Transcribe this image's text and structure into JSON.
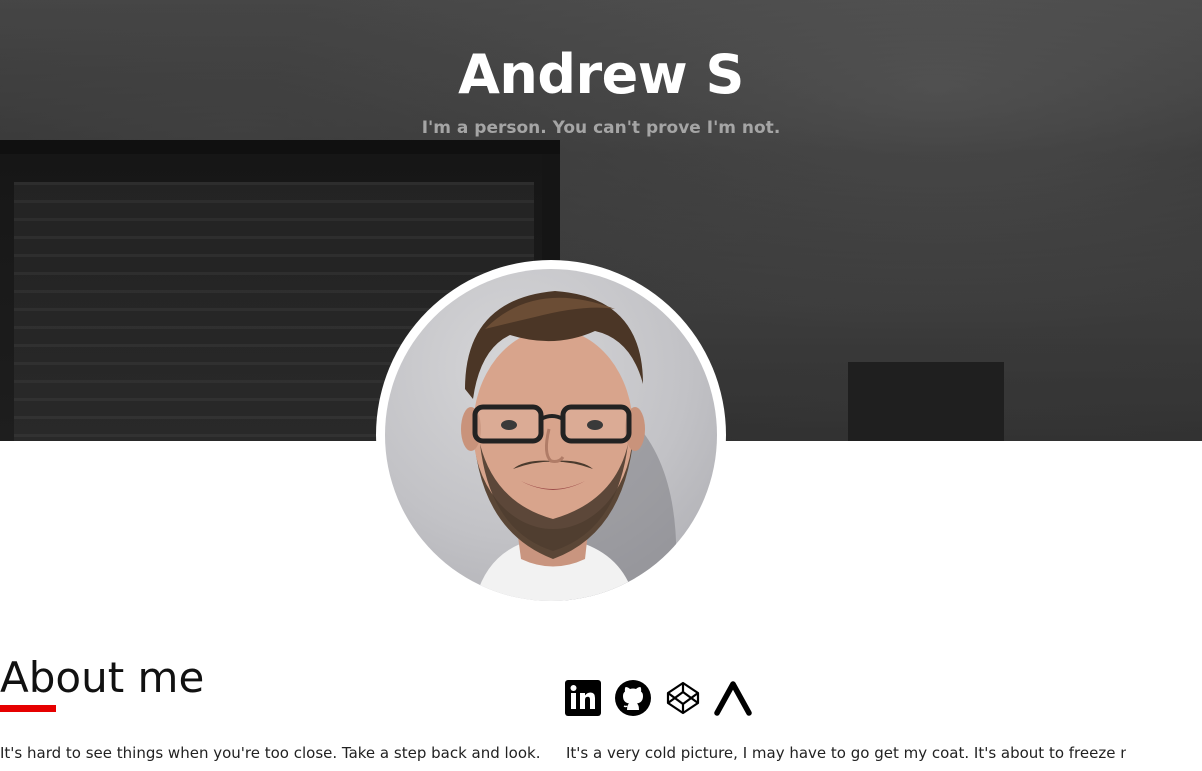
{
  "hero": {
    "title": "Andrew S",
    "subtitle": "I'm a person. You can't prove I'm not."
  },
  "avatar": {
    "alt": "profile-photo"
  },
  "about": {
    "heading": "About me",
    "accent_color": "#e60000",
    "text": "It's hard to see things when you're too close. Take a step back and look. Let's"
  },
  "social": {
    "links": [
      {
        "name": "linkedin-icon"
      },
      {
        "name": "github-icon"
      },
      {
        "name": "codepen-icon"
      },
      {
        "name": "freecodecamp-icon"
      }
    ]
  },
  "right": {
    "text": "It's a very cold picture, I may have to go get my coat. It's about to freeze me"
  }
}
